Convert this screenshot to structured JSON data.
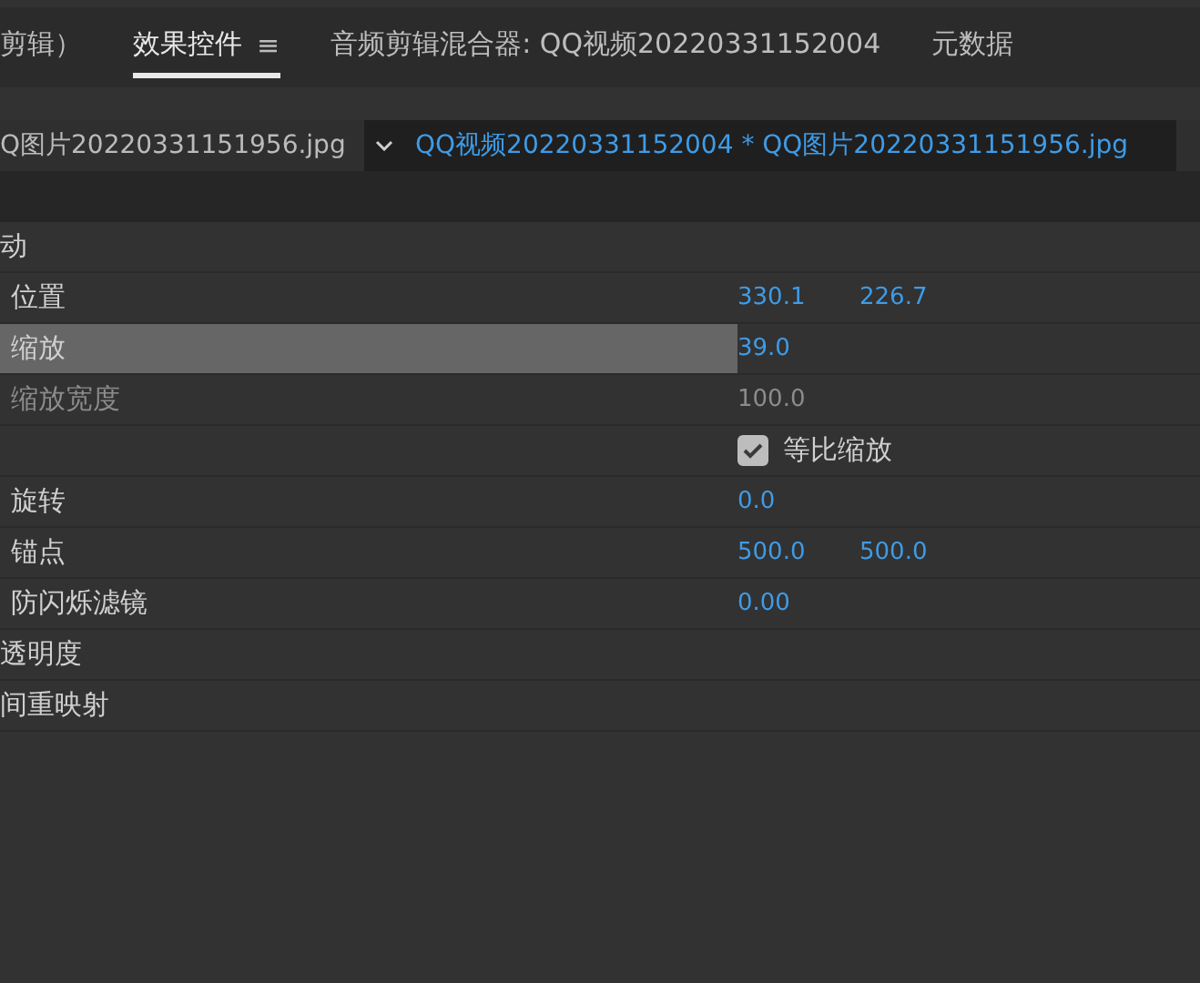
{
  "tabs": [
    {
      "label": "剪辑）",
      "selected": false,
      "menu": false
    },
    {
      "label": "效果控件",
      "selected": true,
      "menu": true
    },
    {
      "label": "音频剪辑混合器: QQ视频20220331152004",
      "selected": false,
      "menu": false
    },
    {
      "label": "元数据",
      "selected": false,
      "menu": false
    }
  ],
  "menu_glyph": "≡",
  "clip": {
    "source": "Q图片20220331151956.jpg",
    "sequence": "QQ视频20220331152004 * QQ图片20220331151956.jpg"
  },
  "rows": [
    {
      "kind": "section",
      "label": "动"
    },
    {
      "kind": "property",
      "label": "位置",
      "values": [
        "330.1",
        "226.7"
      ],
      "selected": false,
      "disabled": false
    },
    {
      "kind": "property",
      "label": "缩放",
      "values": [
        "39.0"
      ],
      "selected": true,
      "disabled": false
    },
    {
      "kind": "property",
      "label": "缩放宽度",
      "values": [
        "100.0"
      ],
      "selected": false,
      "disabled": true
    },
    {
      "kind": "checkbox",
      "label": "等比缩放",
      "checked": true
    },
    {
      "kind": "property",
      "label": "旋转",
      "values": [
        "0.0"
      ],
      "selected": false,
      "disabled": false
    },
    {
      "kind": "property",
      "label": "锚点",
      "values": [
        "500.0",
        "500.0"
      ],
      "selected": false,
      "disabled": false
    },
    {
      "kind": "property",
      "label": "防闪烁滤镜",
      "values": [
        "0.00"
      ],
      "selected": false,
      "disabled": false
    },
    {
      "kind": "section",
      "label": "透明度"
    },
    {
      "kind": "section",
      "label": "间重映射"
    }
  ]
}
